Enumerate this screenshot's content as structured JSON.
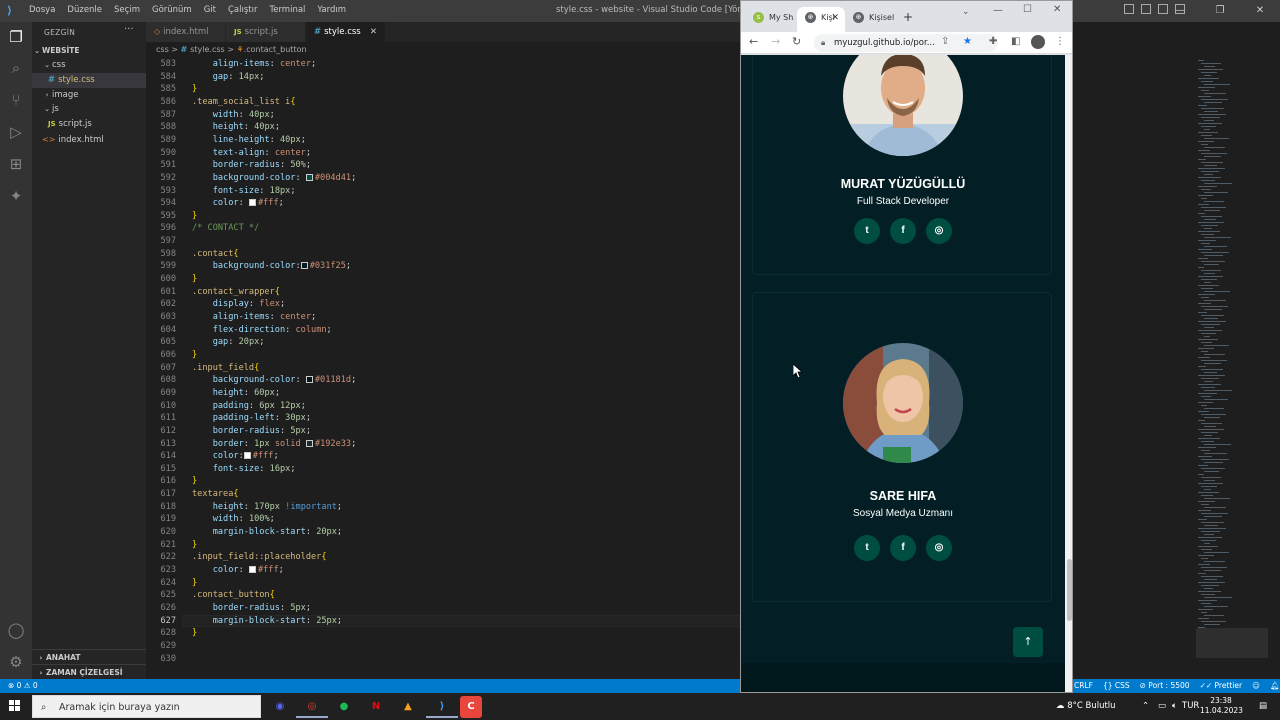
{
  "titlebar": {
    "menu": [
      "Dosya",
      "Düzenle",
      "Seçim",
      "Görünüm",
      "Git",
      "Çalıştır",
      "Terminal",
      "Yardım"
    ],
    "window_title": "style.css - website - Visual Studio Code [Yönetici]"
  },
  "sidebar": {
    "header": "GEZGİN",
    "root": "WEBSİTE",
    "items": [
      {
        "label": "css",
        "type": "folder",
        "open": true
      },
      {
        "label": "style.css",
        "type": "css",
        "selected": true
      },
      {
        "label": "image",
        "type": "folder",
        "open": false
      },
      {
        "label": "js",
        "type": "folder",
        "open": true
      },
      {
        "label": "script.js",
        "type": "js"
      },
      {
        "label": "index.html",
        "type": "html"
      }
    ],
    "outline": "ANAHAT",
    "timeline": "ZAMAN ÇİZELGESİ"
  },
  "tabs": [
    {
      "label": "index.html",
      "icon": "html-icon"
    },
    {
      "label": "script.js",
      "icon": "js-icon"
    },
    {
      "label": "style.css",
      "icon": "css-icon",
      "active": true
    }
  ],
  "breadcrumb": {
    "folder": "css",
    "sep": ">",
    "file": "style.css",
    "symbol": ".contact_button"
  },
  "editor": {
    "current_line": 627,
    "lines": [
      {
        "n": 583,
        "html": "    <span class='prop'>align-items</span>: <span class='val'>center</span>;"
      },
      {
        "n": 584,
        "html": "    <span class='prop'>gap</span>: <span class='num'>14px</span>;"
      },
      {
        "n": 585,
        "html": "<span class='pun'>}</span>"
      },
      {
        "n": 586,
        "html": "<span class='sel'>.team_social_list i</span><span class='pun'>{</span>"
      },
      {
        "n": 587,
        "html": "    <span class='prop'>width</span>: <span class='num'>40px</span>;"
      },
      {
        "n": 588,
        "html": "    <span class='prop'>height</span>: <span class='num'>40px</span>;"
      },
      {
        "n": 589,
        "html": "    <span class='prop'>line-height</span>: <span class='num'>40px</span>;"
      },
      {
        "n": 590,
        "html": "    <span class='prop'>text-align</span>: <span class='val'>center</span>;"
      },
      {
        "n": 591,
        "html": "    <span class='prop'>border-radius</span>: <span class='num'>50%</span>;"
      },
      {
        "n": 592,
        "html": "    <span class='prop'>background-color</span>: <i class='swatch' style='background:#004d41'></i><span class='val'>#004d41</span>;"
      },
      {
        "n": 593,
        "html": "    <span class='prop'>font-size</span>: <span class='num'>18px</span>;"
      },
      {
        "n": 594,
        "html": "    <span class='prop'>color</span>: <i class='swatch' style='background:#fff'></i><span class='val'>#fff</span>;"
      },
      {
        "n": 595,
        "html": "<span class='pun'>}</span>"
      },
      {
        "n": 596,
        "html": "<span class='cmt'>/* CONTACT */</span>"
      },
      {
        "n": 597,
        "html": ""
      },
      {
        "n": 598,
        "html": "<span class='sel'>.contact</span><span class='pun'>{</span>"
      },
      {
        "n": 599,
        "html": "    <span class='prop'>background-color</span>:<i class='swatch' style='background:#031f25'></i><span class='val'>#031f25</span>;"
      },
      {
        "n": 600,
        "html": "<span class='pun'>}</span>"
      },
      {
        "n": 601,
        "html": "<span class='sel'>.contact_wrapper</span><span class='pun'>{</span>"
      },
      {
        "n": 602,
        "html": "    <span class='prop'>display</span>: <span class='val'>flex</span>;"
      },
      {
        "n": 603,
        "html": "    <span class='prop'>align-items</span>: <span class='val'>center</span>;"
      },
      {
        "n": 604,
        "html": "    <span class='prop'>flex-direction</span>: <span class='val'>column</span>;"
      },
      {
        "n": 605,
        "html": "    <span class='prop'>gap</span>: <span class='num'>20px</span>;"
      },
      {
        "n": 606,
        "html": "<span class='pun'>}</span>"
      },
      {
        "n": 607,
        "html": "<span class='sel'>.input_field</span><span class='pun'>{</span>"
      },
      {
        "n": 608,
        "html": "    <span class='prop'>background-color</span>: <i class='swatch' style='background:#01181d'></i><span class='val'>#01181d</span>;"
      },
      {
        "n": 609,
        "html": "    <span class='prop'>height</span>: <span class='num'>60px</span>;"
      },
      {
        "n": 610,
        "html": "    <span class='prop'>padding</span>: <span class='num'>6px 12px</span>;"
      },
      {
        "n": 611,
        "html": "    <span class='prop'>padding-left</span>: <span class='num'>30px</span>;"
      },
      {
        "n": 612,
        "html": "    <span class='prop'>border-radius</span>: <span class='num'>5px</span>;"
      },
      {
        "n": 613,
        "html": "    <span class='prop'>border</span>: <span class='num'>1px</span> <span class='val'>solid</span> <i class='swatch' style='background:#192e33'></i><span class='val'>#192e33</span>;"
      },
      {
        "n": 614,
        "html": "    <span class='prop'>color</span>:<i class='swatch' style='background:#fff'></i><span class='val'>#fff</span>;"
      },
      {
        "n": 615,
        "html": "    <span class='prop'>font-size</span>: <span class='num'>16px</span>;"
      },
      {
        "n": 616,
        "html": "<span class='pun'>}</span>"
      },
      {
        "n": 617,
        "html": "<span class='sel'>textarea</span><span class='pun'>{</span>"
      },
      {
        "n": 618,
        "html": "    <span class='prop'>height</span>: <span class='num'>170px</span> <span class='imp'>!important</span>;"
      },
      {
        "n": 619,
        "html": "    <span class='prop'>width</span>: <span class='num'>100%</span>;"
      },
      {
        "n": 620,
        "html": "    <span class='prop'>margin-block-start</span>: <span class='num'>20px</span>;"
      },
      {
        "n": 621,
        "html": "<span class='pun'>}</span>"
      },
      {
        "n": 622,
        "html": "<span class='sel'>.input_field::placeholder</span><span class='pun'>{</span>"
      },
      {
        "n": 623,
        "html": "    <span class='prop'>color</span>: <i class='swatch' style='background:#fff'></i><span class='val'>#fff</span>;"
      },
      {
        "n": 624,
        "html": "<span class='pun'>}</span>"
      },
      {
        "n": 625,
        "html": "<span class='sel'>.contact_button</span><span class='pun'>{</span>"
      },
      {
        "n": 626,
        "html": "    <span class='prop'>border-radius</span>: <span class='num'>5px</span>;"
      },
      {
        "n": 627,
        "html": "    <span class='prop'>margin-block-start</span>: <span class='num'>25px</span>;"
      },
      {
        "n": 628,
        "html": "<span class='pun'>}</span>"
      },
      {
        "n": 629,
        "html": ""
      },
      {
        "n": 630,
        "html": ""
      }
    ]
  },
  "statusbar": {
    "left": "⊗ 0  ⚠ 0",
    "right": [
      "CRLF",
      "{} CSS",
      "⊘ Port : 5500",
      "✓✓ Prettier"
    ]
  },
  "chrome": {
    "tabs": [
      {
        "label": "My Sh",
        "icon": "shopify-icon"
      },
      {
        "label": "Kişi",
        "icon": "globe-icon",
        "active": true
      },
      {
        "label": "Kişisel",
        "icon": "globe-icon"
      }
    ],
    "new_tab": "+",
    "url": "myuzgul.github.io/por...",
    "team": [
      {
        "name": "MURAT YÜZÜGÜLLÜ",
        "role": "Full Stack Developer"
      },
      {
        "name": "SARE HIFA",
        "role": "Sosyal Medya Uzmanı"
      }
    ],
    "social": [
      "t",
      "f",
      "◎"
    ],
    "to_top": "↑"
  },
  "taskbar": {
    "search_placeholder": "Aramak için buraya yazın",
    "weather": "8°C  Bulutlu",
    "lang": "TUR",
    "time": "23:38",
    "date": "11.04.2023"
  },
  "colors": {
    "accent": "#007acc",
    "site_bg": "#031f25",
    "social_bg": "#004d41"
  }
}
